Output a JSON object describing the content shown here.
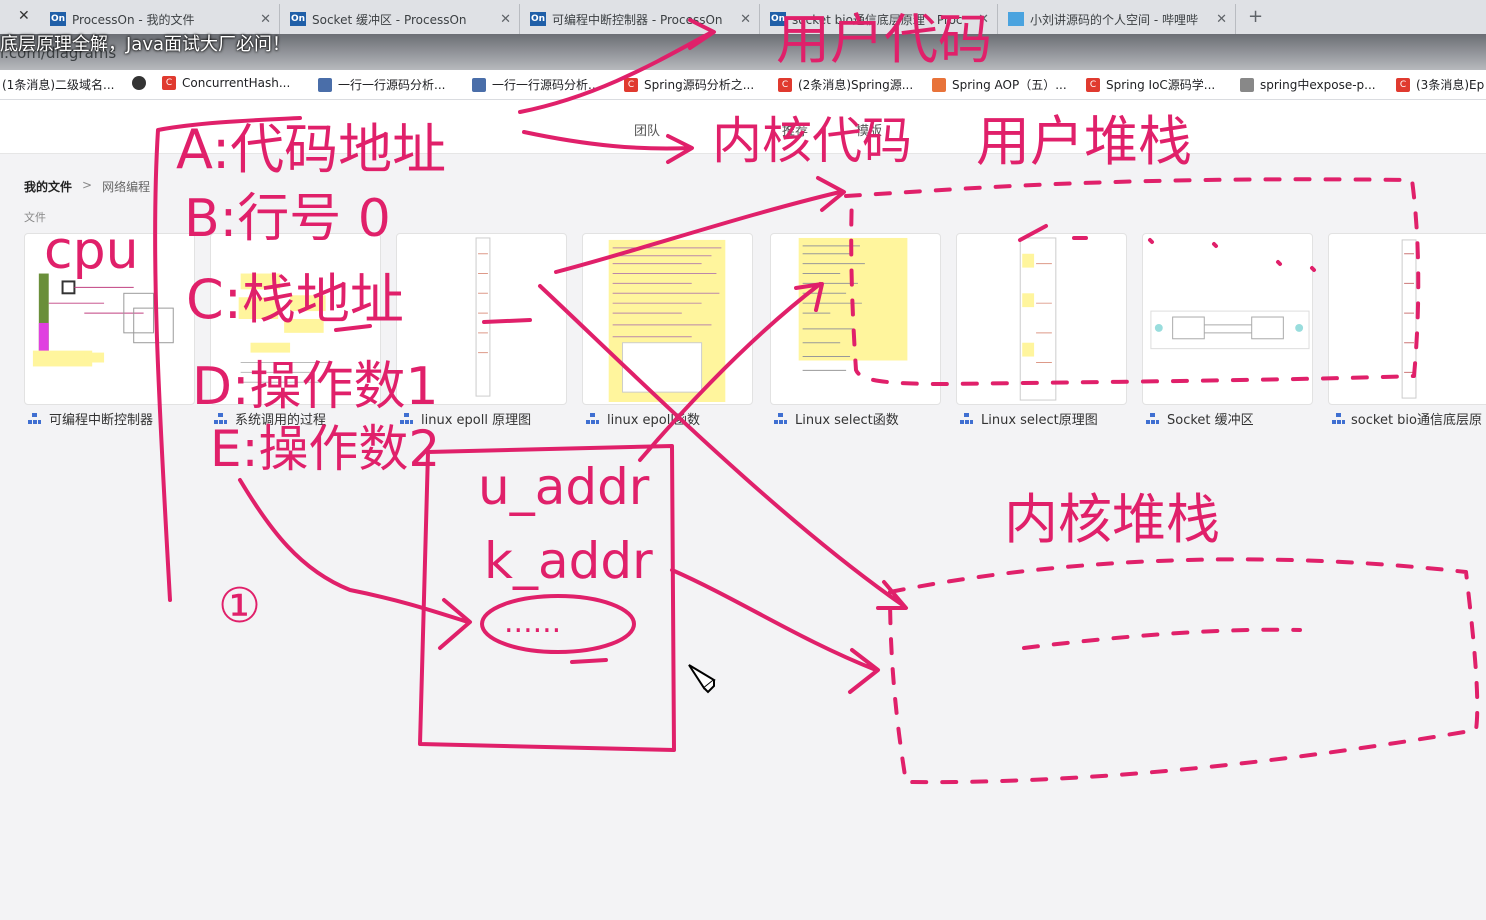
{
  "browser": {
    "tabs": [
      {
        "title": "ProcessOn - 我的文件",
        "fav": "On"
      },
      {
        "title": "Socket 缓冲区 - ProcessOn",
        "fav": "On"
      },
      {
        "title": "可编程中断控制器 - ProcessOn",
        "fav": "On"
      },
      {
        "title": "socket bio通信底层原理 - Proc",
        "fav": "On"
      },
      {
        "title": "小刘讲源码的个人空间 - 哔哩哔",
        "fav": ""
      }
    ],
    "url_fragment": "l.com/diagrams",
    "bookmarks": [
      {
        "label": "(1条消息)二级域名...",
        "icon": "leaf"
      },
      {
        "label": "ConcurrentHash...",
        "icon": "c"
      },
      {
        "label": "一行一行源码分析...",
        "icon": "doc"
      },
      {
        "label": "一行一行源码分析...",
        "icon": "doc"
      },
      {
        "label": "Spring源码分析之...",
        "icon": "c"
      },
      {
        "label": "(2条消息)Spring源...",
        "icon": "c"
      },
      {
        "label": "Spring AOP（五）...",
        "icon": "jian"
      },
      {
        "label": "Spring IoC源码学...",
        "icon": "c"
      },
      {
        "label": "spring中expose-p...",
        "icon": "leaf"
      },
      {
        "label": "(3条消息)Ep",
        "icon": "c"
      }
    ]
  },
  "video_title": "底层原理全解，Java面试大厂必问！",
  "app": {
    "nav": [
      "团队",
      "推荐",
      "模版"
    ],
    "breadcrumb": [
      "我的文件",
      "网络编程"
    ],
    "section": "文件",
    "files": [
      "可编程中断控制器",
      "系统调用的过程",
      "linux epoll 原理图",
      "linux epoll函数",
      "Linux select函数",
      "Linux select原理图",
      "Socket 缓冲区",
      "socket bio通信底层原"
    ]
  },
  "handwriting": {
    "cpu": "cpu",
    "a": "A:代码地址",
    "b": "B:行号 0",
    "c": "C:栈地址",
    "d": "D:操作数1",
    "e": "E:操作数2",
    "user_code": "用户代码",
    "kernel_code": "内核代码",
    "user_stack": "用户堆栈",
    "kernel_stack": "内核堆栈",
    "u_addr": "u_addr",
    "k_addr": "k_addr",
    "ellipsis": "......",
    "circle_one": "①"
  },
  "colors": {
    "ink": "#e0206a",
    "brand": "#1f5fa8"
  }
}
